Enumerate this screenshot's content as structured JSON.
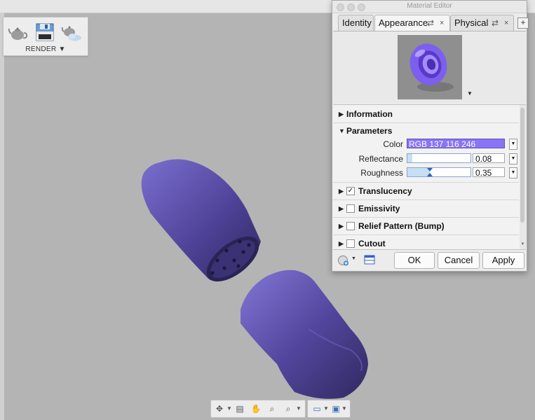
{
  "render_toolbar": {
    "label": "RENDER",
    "icons": [
      "teapot-icon",
      "render-save-icon",
      "cloud-render-icon"
    ]
  },
  "model": {
    "body_color": "#5a4ea8"
  },
  "material_editor": {
    "title": "Material Editor",
    "tabs": [
      {
        "label": "Identity",
        "active": false
      },
      {
        "label": "Appearance",
        "active": true,
        "swap": "⇄",
        "close": "×"
      },
      {
        "label": "Physical",
        "active": false,
        "swap": "⇄",
        "close": "×"
      }
    ],
    "add_tab": "+",
    "sections": {
      "information": "Information",
      "parameters": "Parameters",
      "translucency": "Translucency",
      "emissivity": "Emissivity",
      "relief": "Relief Pattern (Bump)",
      "cutout": "Cutout"
    },
    "checks": {
      "translucency": true,
      "emissivity": false,
      "relief": false,
      "cutout": false
    },
    "parameters": {
      "color_label": "Color",
      "color_value": "RGB 137 116 246",
      "color_hex": "#8974f6",
      "reflectance_label": "Reflectance",
      "reflectance_value": "0.08",
      "reflectance_level": 0.08,
      "roughness_label": "Roughness",
      "roughness_value": "0.35",
      "roughness_level": 0.35
    },
    "buttons": {
      "ok": "OK",
      "cancel": "Cancel",
      "apply": "Apply"
    }
  }
}
